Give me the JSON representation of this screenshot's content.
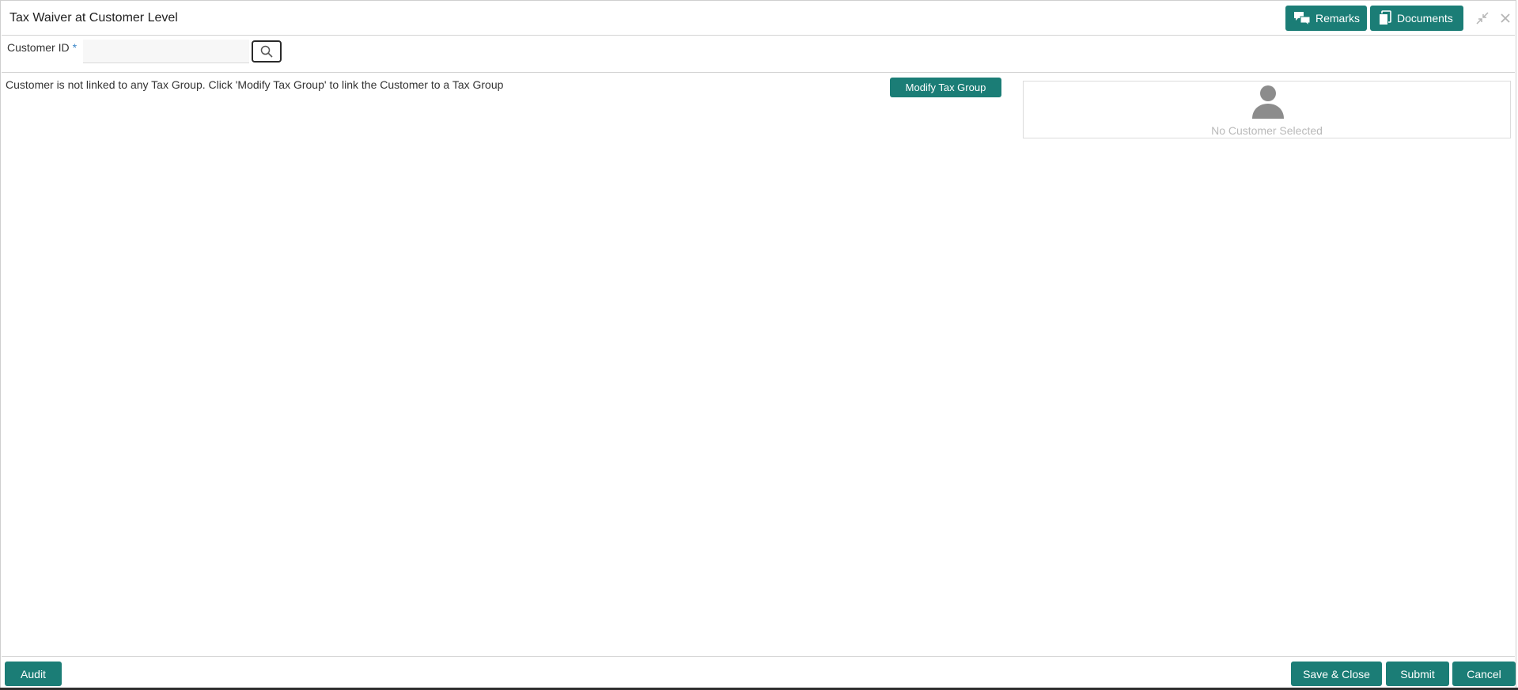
{
  "window": {
    "title": "Tax Waiver at Customer Level",
    "remarks_label": "Remarks",
    "documents_label": "Documents"
  },
  "customer": {
    "label": "Customer ID",
    "required_mark": "*",
    "value": ""
  },
  "body": {
    "message": "Customer is not linked to any Tax Group. Click 'Modify Tax Group' to link the Customer to a Tax Group",
    "modify_button": "Modify Tax Group",
    "no_customer": "No Customer Selected"
  },
  "footer": {
    "audit": "Audit",
    "save_close": "Save & Close",
    "submit": "Submit",
    "cancel": "Cancel"
  },
  "colors": {
    "accent": "#1b7d76",
    "required": "#3a86c8"
  },
  "icons": [
    "chat-icon",
    "document-icon",
    "minimize-icon",
    "close-icon",
    "search-icon",
    "avatar-icon"
  ]
}
